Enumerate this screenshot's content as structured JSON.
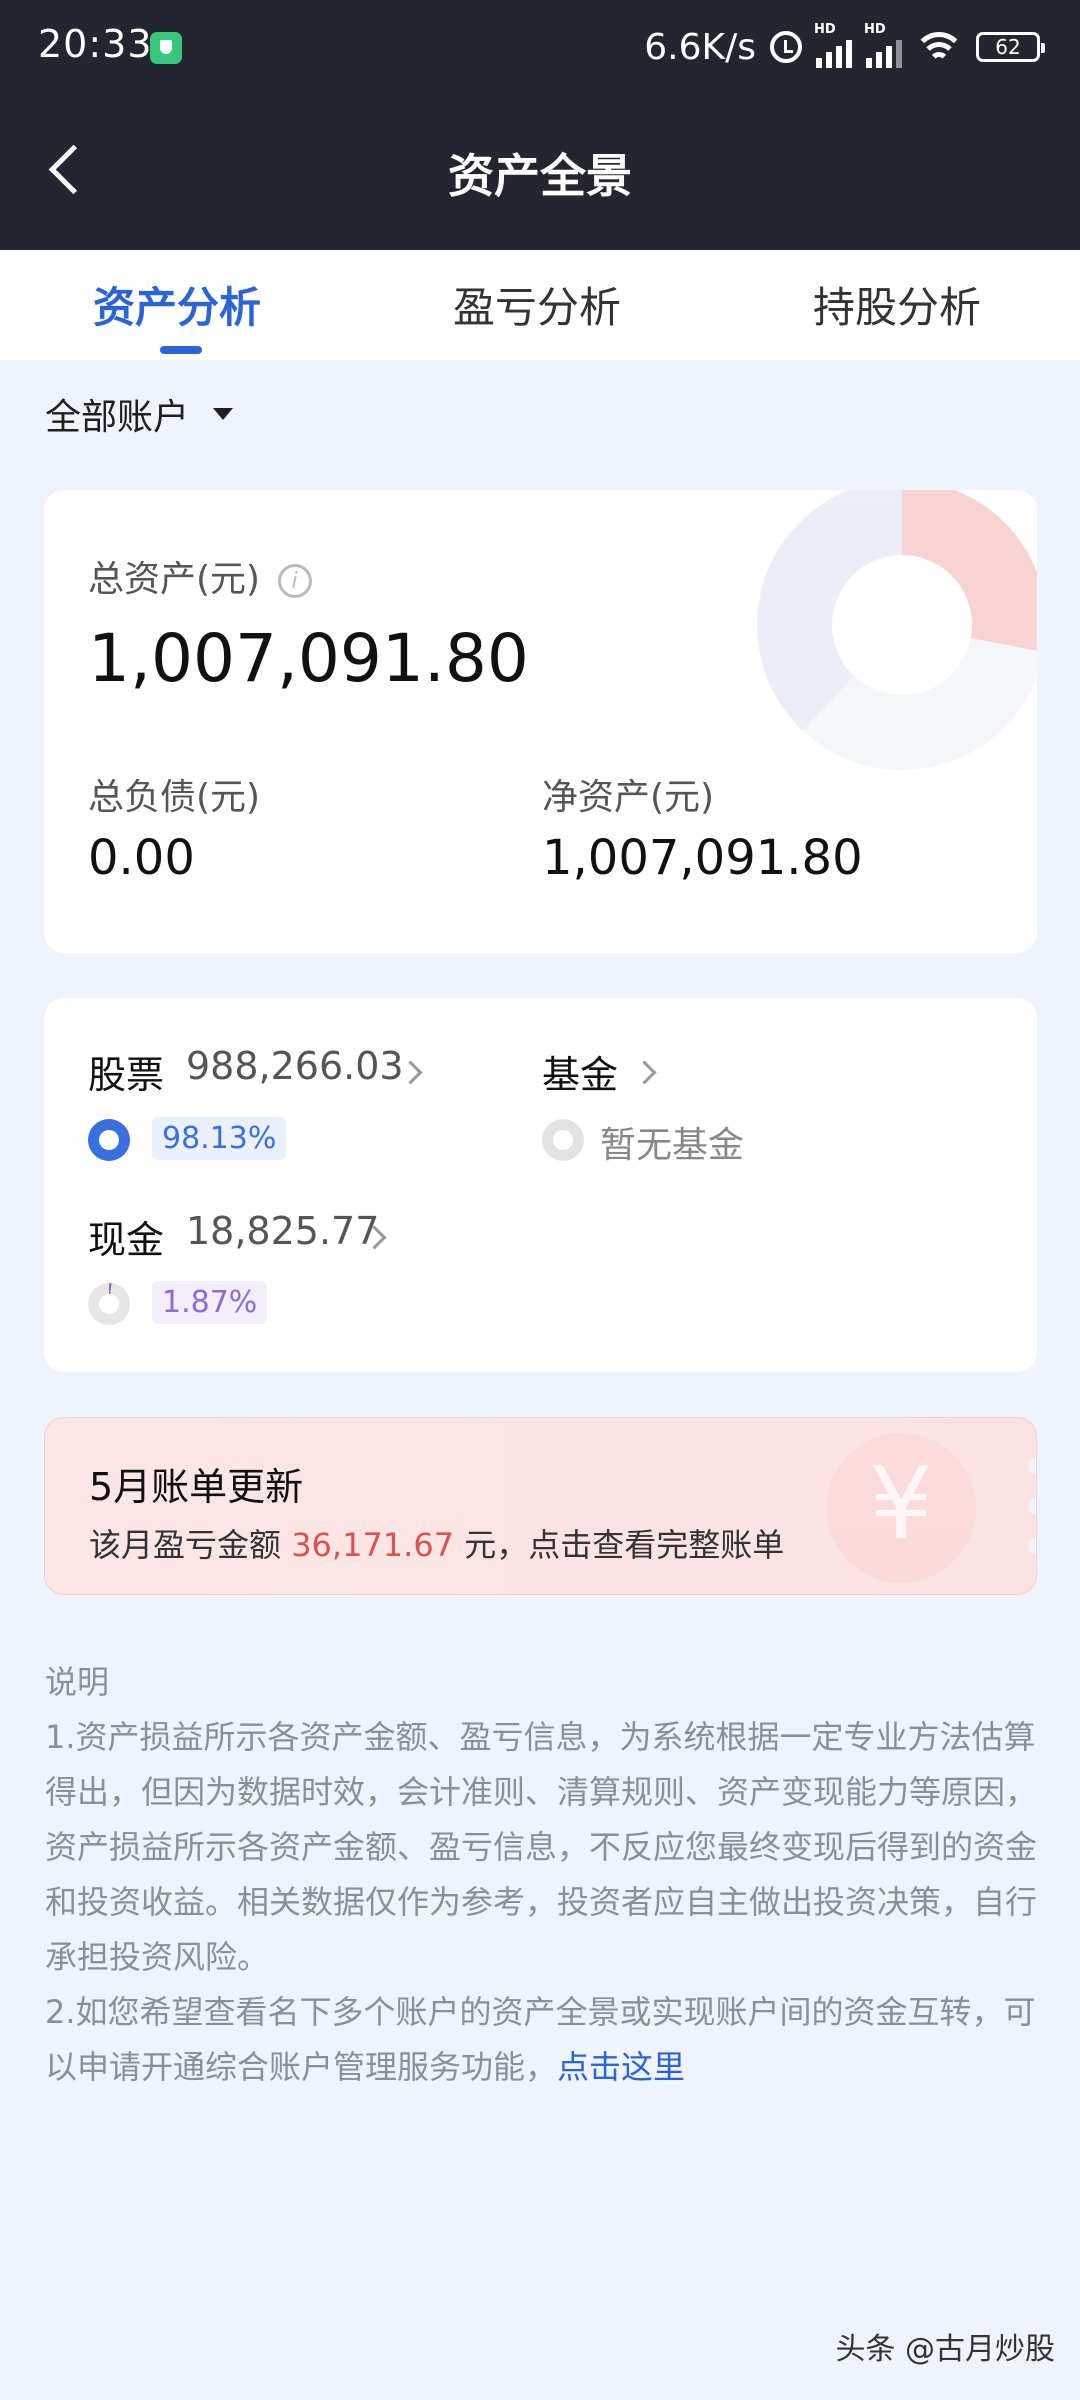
{
  "status_bar": {
    "time": "20:33",
    "net_speed": "6.6K/s",
    "signal_badge": "HD",
    "battery": "62"
  },
  "header": {
    "title": "资产全景"
  },
  "tabs": [
    {
      "label": "资产分析",
      "active": true
    },
    {
      "label": "盈亏分析",
      "active": false
    },
    {
      "label": "持股分析",
      "active": false
    }
  ],
  "account_selector": {
    "label": "全部账户"
  },
  "summary": {
    "total_assets_label": "总资产(元)",
    "total_assets_value": "1,007,091.80",
    "liabilities_label": "总负债(元)",
    "liabilities_value": "0.00",
    "net_assets_label": "净资产(元)",
    "net_assets_value": "1,007,091.80"
  },
  "allocation": {
    "stock": {
      "label": "股票",
      "amount": "988,266.03",
      "percent": "98.13%"
    },
    "fund": {
      "label": "基金",
      "empty_text": "暂无基金"
    },
    "cash": {
      "label": "现金",
      "amount": "18,825.77",
      "percent": "1.87%"
    }
  },
  "bill": {
    "title": "5月账单更新",
    "text_prefix": "该月盈亏金额 ",
    "amount": "36,171.67",
    "text_suffix": " 元，点击查看完整账单",
    "icon": "yen-icon"
  },
  "explanation": {
    "heading": "说明",
    "item1": "1.资产损益所示各资产金额、盈亏信息，为系统根据一定专业方法估算得出，但因为数据时效，会计准则、清算规则、资产变现能力等原因，资产损益所示各资产金额、盈亏信息，不反应您最终变现后得到的资金和投资收益。相关数据仅作为参考，投资者应自主做出投资决策，自行承担投资风险。",
    "item2": "2.如您希望查看名下多个账户的资产全景或实现账户间的资金互转，可以申请开通综合账户管理服务功能，",
    "link": "点击这里"
  },
  "watermark": "头条 @古月炒股",
  "colors": {
    "accent": "#2b63d8",
    "header_bg": "#23252f",
    "stock_ring": "#3a6fe0",
    "cash_ring": "#8b6dd6",
    "bill_amount": "#d9534f"
  }
}
